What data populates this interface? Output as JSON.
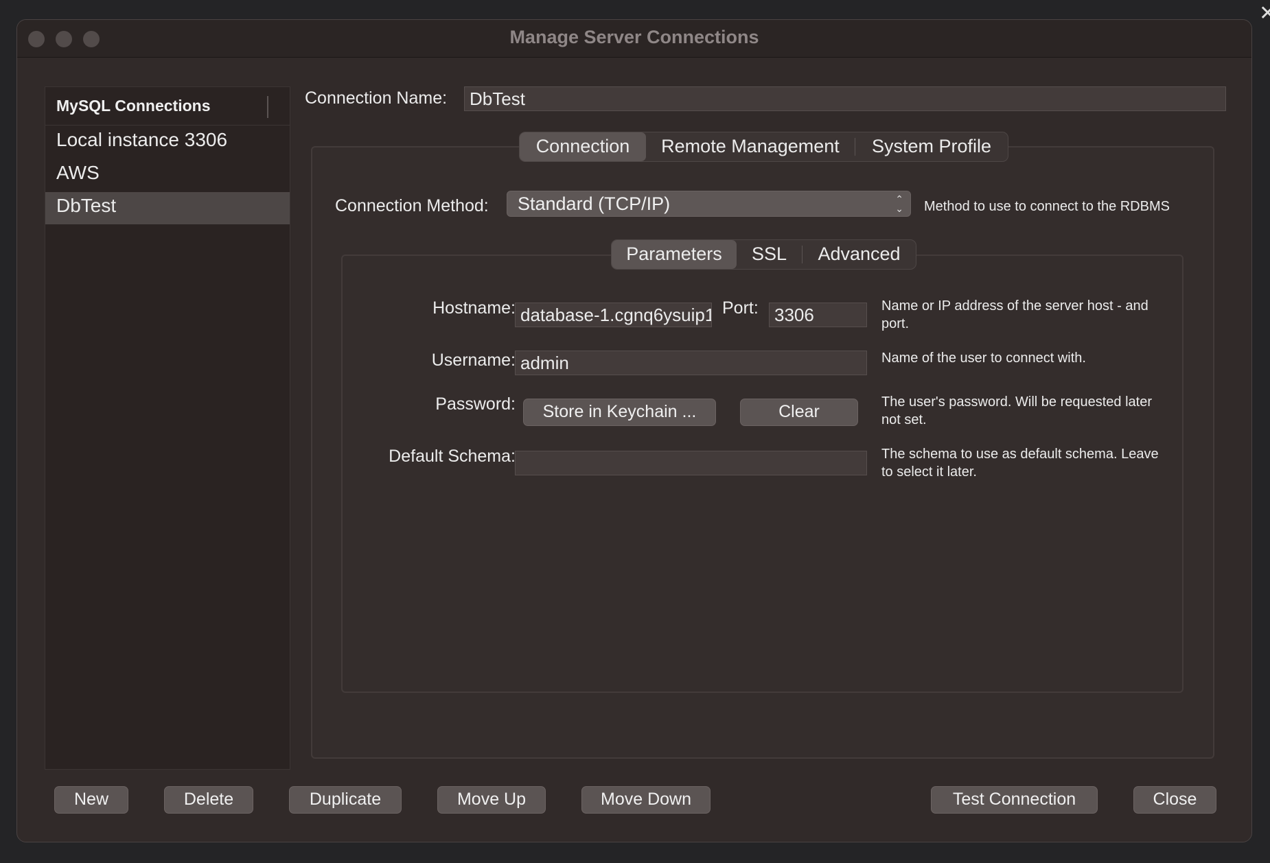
{
  "window": {
    "title": "Manage Server Connections"
  },
  "sidebar": {
    "header": "MySQL Connections",
    "items": [
      {
        "label": "Local instance 3306"
      },
      {
        "label": "AWS"
      },
      {
        "label": "DbTest"
      }
    ],
    "selected_item": "DbTest"
  },
  "connection_name": {
    "label": "Connection Name:",
    "value": "DbTest"
  },
  "main_tabs": [
    {
      "label": "Connection"
    },
    {
      "label": "Remote Management"
    },
    {
      "label": "System Profile"
    }
  ],
  "main_tab_selected": "Connection",
  "method": {
    "label": "Connection Method:",
    "value": "Standard (TCP/IP)",
    "help": "Method to use to connect to the RDBMS"
  },
  "param_tabs": [
    {
      "label": "Parameters"
    },
    {
      "label": "SSL"
    },
    {
      "label": "Advanced"
    }
  ],
  "param_tab_selected": "Parameters",
  "params": {
    "hostname": {
      "label": "Hostname:",
      "value": "database-1.cgnq6ysuip1",
      "help_line1": "Name or IP address of the server host - and",
      "help_line2": "port."
    },
    "port": {
      "label": "Port:",
      "value": "3306"
    },
    "username": {
      "label": "Username:",
      "value": "admin",
      "help": "Name of the user to connect with."
    },
    "password": {
      "label": "Password:",
      "store_button": "Store in Keychain ...",
      "clear_button": "Clear",
      "help_line1": "The user's password. Will be requested later",
      "help_line2": "not set."
    },
    "schema": {
      "label": "Default Schema:",
      "value": "",
      "help_line1": "The schema to use as default schema. Leave",
      "help_line2": "to select it later."
    }
  },
  "footer": {
    "new": "New",
    "delete": "Delete",
    "duplicate": "Duplicate",
    "move_up": "Move Up",
    "move_down": "Move Down",
    "test_connection": "Test Connection",
    "close": "Close"
  },
  "colors": {
    "window_bg": "#312a29",
    "selection_bg": "#4d4746",
    "button_bg": "#5b5453",
    "field_bg": "#433b3a"
  }
}
